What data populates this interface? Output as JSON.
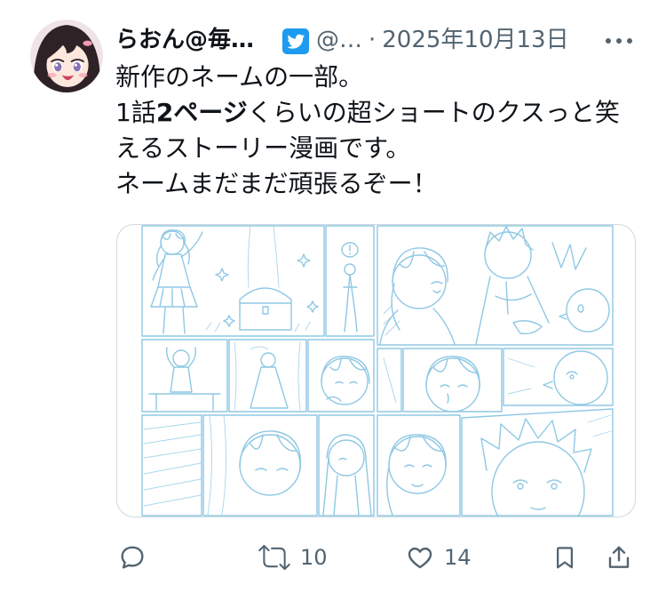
{
  "tweet": {
    "author": {
      "display_name": "らおん@毎…",
      "badge_icon": "twitter-bird-badge-icon",
      "handle": "@…",
      "separator": "·",
      "date": "2025年10月13日"
    },
    "more_icon": "more-dots-icon",
    "body": {
      "line1": "新作のネームの一部。",
      "line2_start": "1話",
      "line2_bold": "2ページ",
      "line2_end": "くらいの超ショートのクスっと笑",
      "line3": "えるストーリー漫画です。",
      "line4": "ネームまだまだ頑張るぞー！"
    },
    "actions": {
      "reply": {
        "icon": "reply-icon"
      },
      "retweet": {
        "icon": "retweet-icon",
        "count": "10"
      },
      "like": {
        "icon": "heart-icon",
        "count": "14"
      },
      "bookmark": {
        "icon": "bookmark-icon"
      },
      "share": {
        "icon": "share-icon"
      }
    }
  },
  "colors": {
    "text": "#0f1419",
    "secondary": "#536471",
    "border": "#cfd9de",
    "badge": "#1d9bf0",
    "sketch": "#8fc8e4"
  }
}
